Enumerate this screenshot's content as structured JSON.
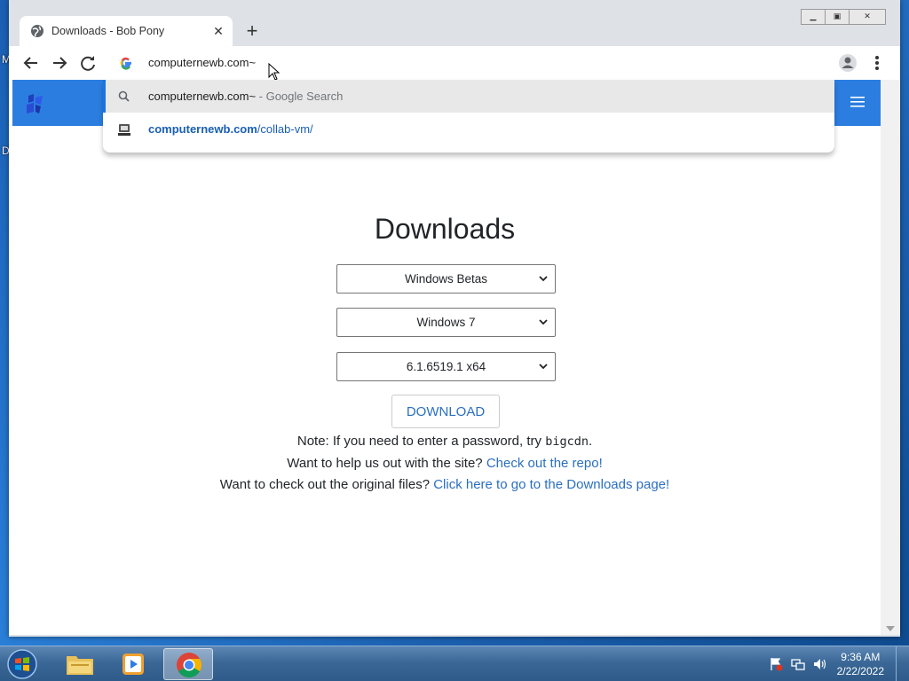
{
  "desktop": {
    "frag1": "M",
    "frag2": "D"
  },
  "browser": {
    "tab_title": "Downloads - Bob Pony",
    "tab_close": "✕",
    "new_tab": "+",
    "omnibox_text": "computernewb.com~",
    "suggestions": [
      {
        "main": "computernewb.com~",
        "suffix": " - Google Search"
      },
      {
        "bold": "computernewb.com",
        "rest": "/collab-vm/"
      }
    ]
  },
  "page": {
    "heading": "Downloads",
    "selects": [
      "Windows Betas",
      "Windows 7",
      "6.1.6519.1 x64"
    ],
    "download_button": "DOWNLOAD",
    "note_prefix": "Note: If you need to enter a password, try ",
    "note_code": "bigcdn",
    "note_suffix": ".",
    "help_prefix": "Want to help us out with the site? ",
    "help_link": "Check out the repo!",
    "orig_prefix": "Want to check out the original files? ",
    "orig_link": "Click here to go to the Downloads page!"
  },
  "taskbar": {
    "time": "9:36 AM",
    "date": "2/22/2022"
  },
  "colors": {
    "accent": "#2b7de0",
    "link": "#2b6fc0"
  }
}
